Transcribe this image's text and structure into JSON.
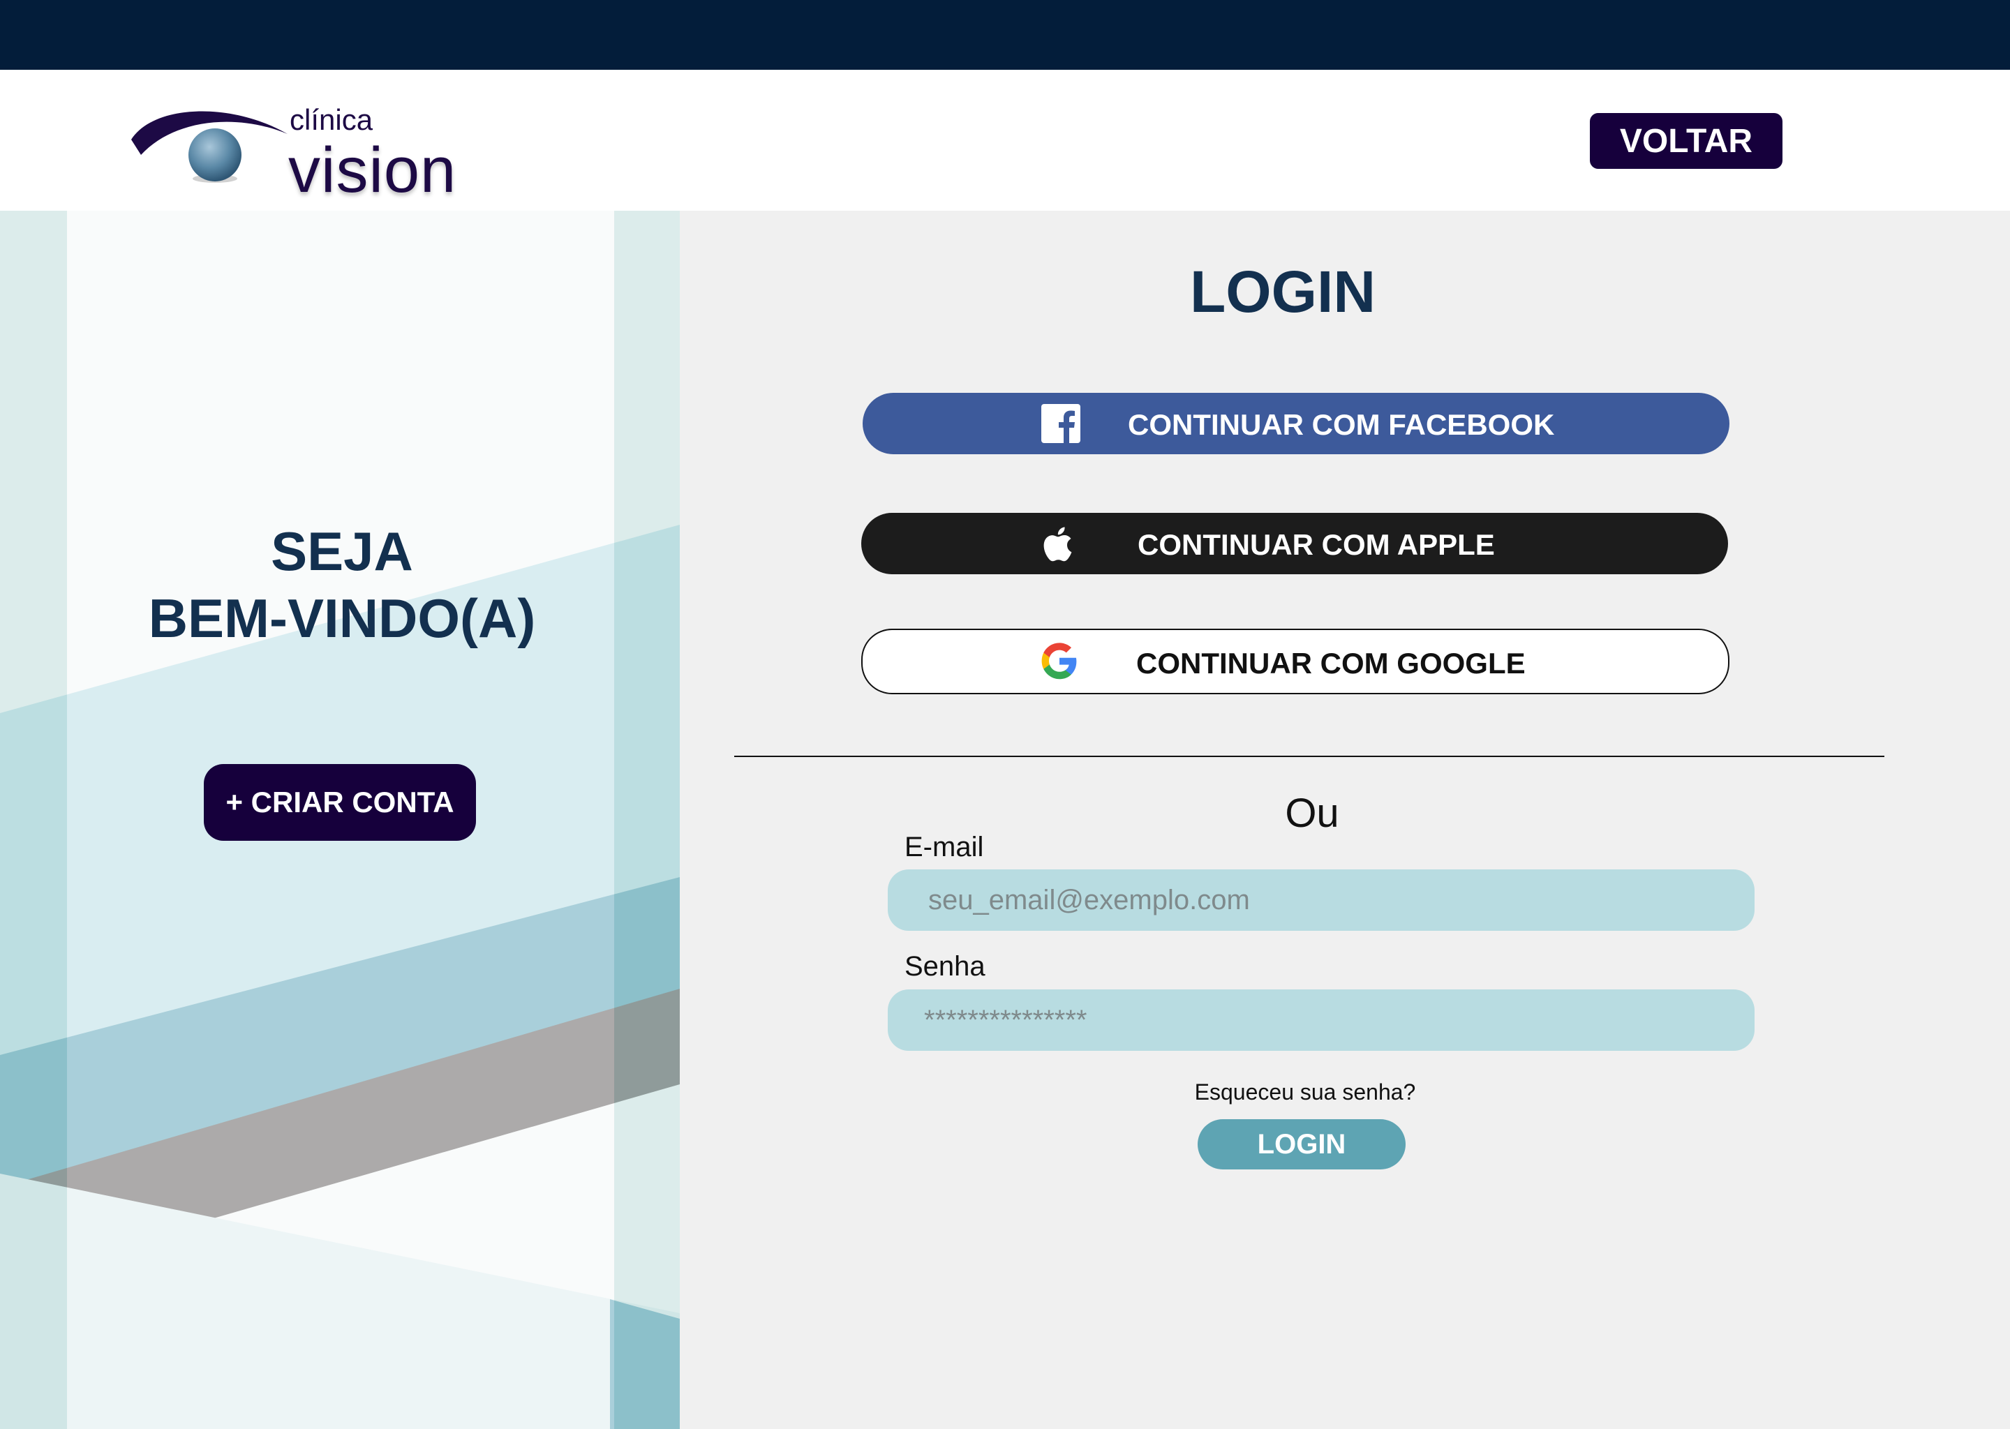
{
  "header": {
    "logo_small": "clínica",
    "logo_big": "vision",
    "back_label": "VOLTAR"
  },
  "welcome": {
    "line1": "SEJA",
    "line2": "BEM-VINDO(A)",
    "create_label": "+ CRIAR CONTA"
  },
  "login": {
    "title": "LOGIN",
    "facebook_label": "CONTINUAR COM FACEBOOK",
    "apple_label": "CONTINUAR COM APPLE",
    "google_label": "CONTINUAR COM GOOGLE",
    "or_label": "Ou",
    "email_label": "E-mail",
    "email_placeholder": "seu_email@exemplo.com",
    "password_label": "Senha",
    "password_placeholder": "***************",
    "forgot_label": "Esqueceu sua senha?",
    "submit_label": "LOGIN"
  },
  "colors": {
    "navy": "#031d3a",
    "primary_dark": "#16003c",
    "facebook": "#3d5a9b",
    "apple": "#1c1c1c",
    "input_bg": "#b8dce1",
    "login_button": "#5ea4b3",
    "heading": "#13304f"
  },
  "icons": [
    "eye-logo-icon",
    "facebook-icon",
    "apple-icon",
    "google-icon"
  ]
}
